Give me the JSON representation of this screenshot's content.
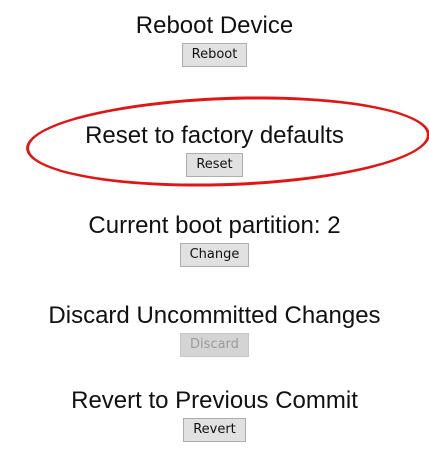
{
  "sections": {
    "reboot": {
      "title": "Reboot Device",
      "button_label": "Reboot",
      "button_enabled": true
    },
    "reset": {
      "title": "Reset to factory defaults",
      "button_label": "Reset",
      "button_enabled": true
    },
    "partition": {
      "title": "Current boot partition: 2",
      "button_label": "Change",
      "button_enabled": true
    },
    "discard": {
      "title": "Discard Uncommitted Changes",
      "button_label": "Discard",
      "button_enabled": false
    },
    "revert": {
      "title": "Revert to Previous Commit",
      "button_label": "Revert",
      "button_enabled": true
    }
  },
  "colors": {
    "highlight": "#e01515",
    "button_bg": "#e1e1e1",
    "button_disabled_text": "#9a9a9a"
  }
}
